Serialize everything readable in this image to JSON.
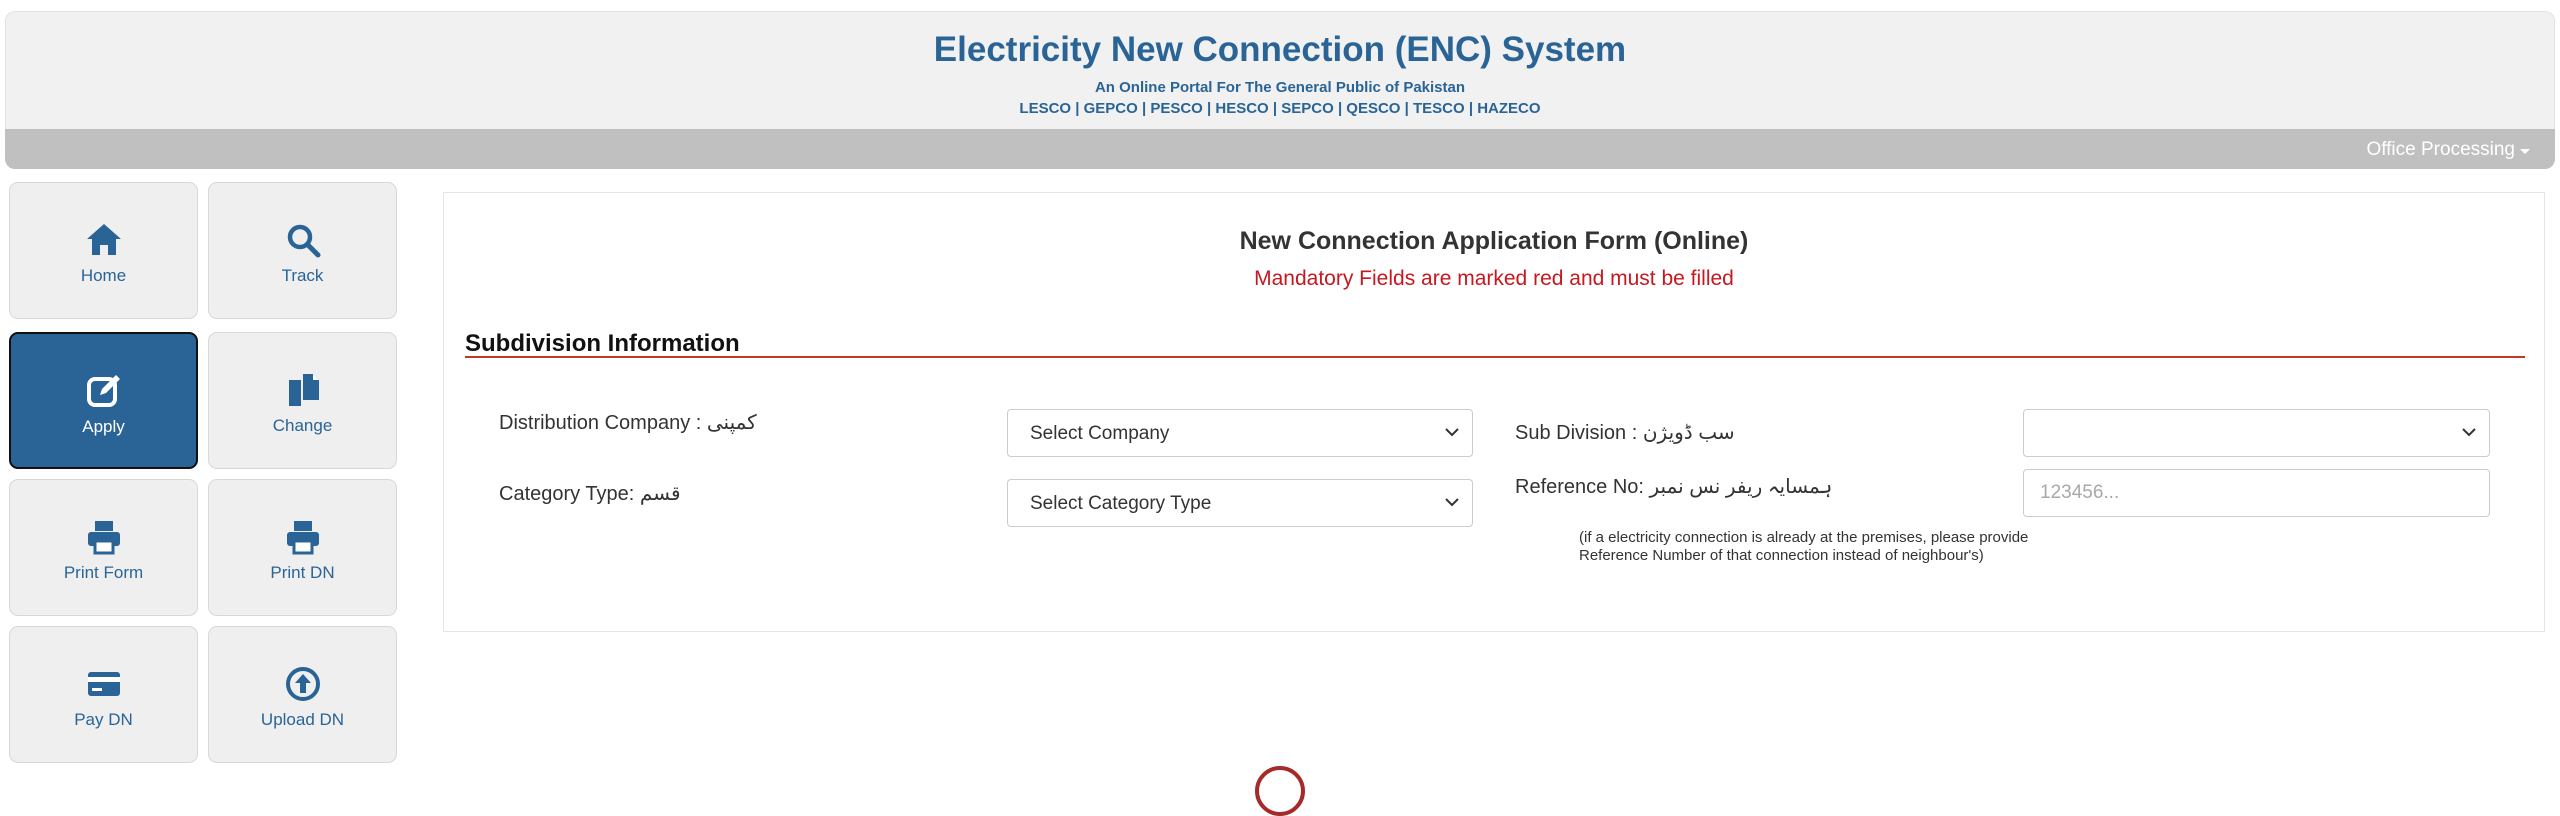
{
  "header": {
    "title": "Electricity New Connection (ENC) System",
    "subtitle": "An Online Portal For The General Public of Pakistan",
    "companies": "LESCO | GEPCO | PESCO | HESCO | SEPCO | QESCO | TESCO | HAZECO"
  },
  "navbar": {
    "menu_label": "Office Processing"
  },
  "sidebar": {
    "items": [
      {
        "label": "Home",
        "icon": "home-icon"
      },
      {
        "label": "Track",
        "icon": "search-icon"
      },
      {
        "label": "Apply",
        "icon": "edit-icon",
        "active": true
      },
      {
        "label": "Change",
        "icon": "copy-icon"
      },
      {
        "label": "Print Form",
        "icon": "printer-icon"
      },
      {
        "label": "Print DN",
        "icon": "printer-icon"
      },
      {
        "label": "Pay DN",
        "icon": "credit-card-icon"
      },
      {
        "label": "Upload DN",
        "icon": "upload-icon"
      }
    ]
  },
  "form": {
    "title": "New Connection Application Form (Online)",
    "mandatory_note": "Mandatory Fields are marked red and must be filled",
    "section_title": "Subdivision Information",
    "distribution_company_label": "Distribution Company : کمپنی",
    "distribution_company_value": "Select Company",
    "sub_division_label": "Sub Division : سب ڈویژن",
    "sub_division_value": "",
    "category_type_label": "Category Type:  قسم",
    "category_type_value": "Select Category Type",
    "reference_no_label": "Reference No: ہمسایہ ریفر نس نمبر",
    "reference_no_placeholder": "123456...",
    "reference_no_helper": "(if a electricity connection is already at the premises, please provide Reference Number of that connection instead of neighbour's)"
  },
  "colors": {
    "brand_blue": "#2a6496",
    "mandatory_red": "#c8171e",
    "section_rule": "#c0392b",
    "navbar_gray": "#c0c0c0"
  }
}
